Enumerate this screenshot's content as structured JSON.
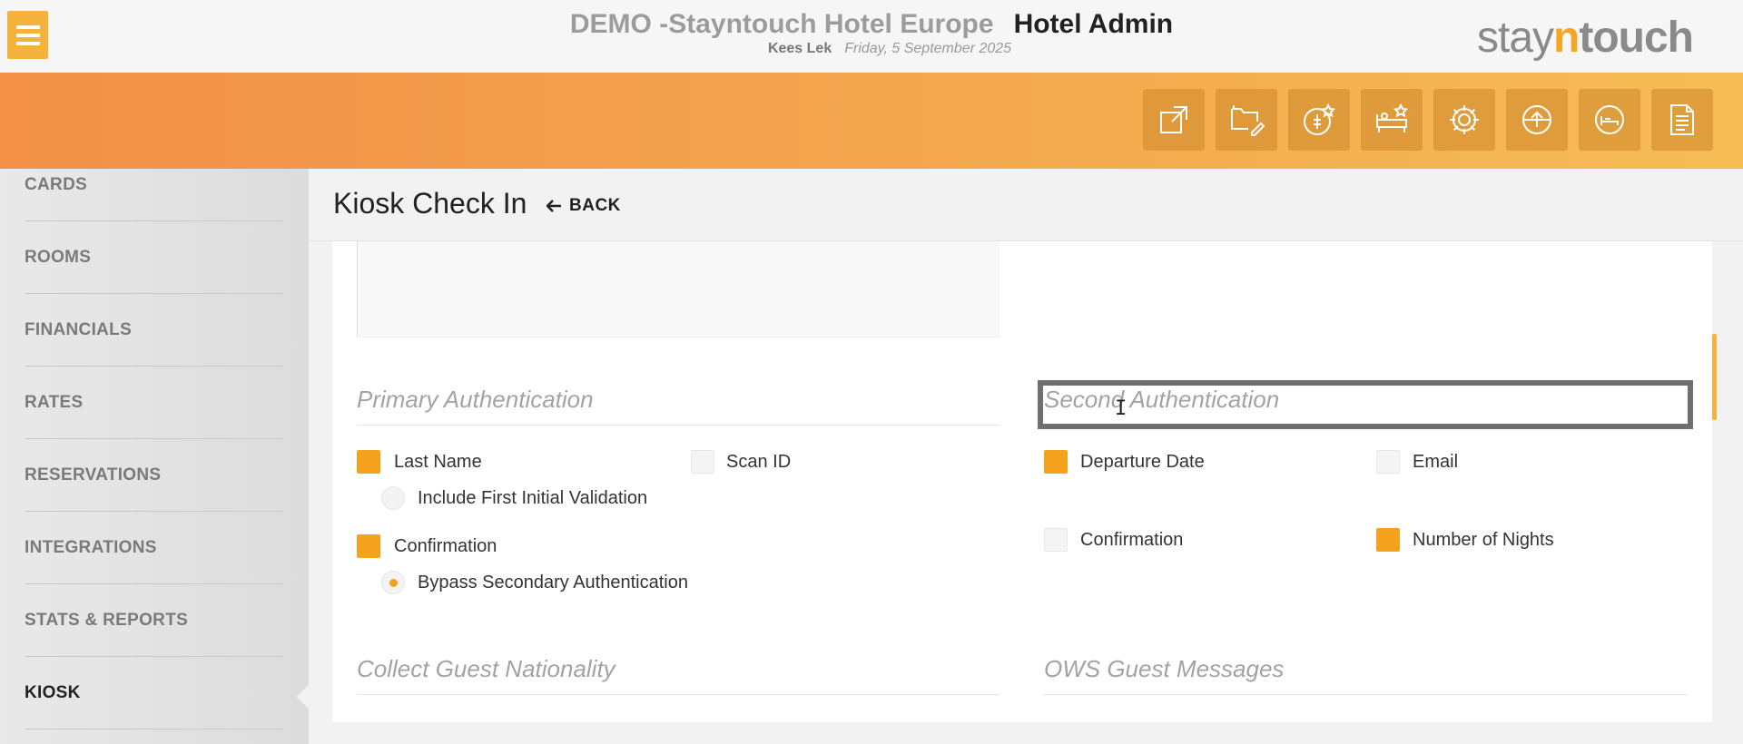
{
  "header": {
    "hotel_name": "DEMO -Stayntouch Hotel Europe",
    "app_name": "Hotel Admin",
    "user": "Kees Lek",
    "date": "Friday, 5 September 2025",
    "logo": {
      "part1": "stay",
      "part2": "n",
      "part3": "touch"
    }
  },
  "toolbar": {
    "icons": [
      "external-link-icon",
      "folder-edit-icon",
      "rate-star-icon",
      "housekeeping-icon",
      "gear-icon",
      "upload-icon",
      "bed-icon",
      "document-icon"
    ]
  },
  "sidebar": {
    "items": [
      {
        "label": "CARDS"
      },
      {
        "label": "ROOMS"
      },
      {
        "label": "FINANCIALS"
      },
      {
        "label": "RATES"
      },
      {
        "label": "RESERVATIONS"
      },
      {
        "label": "INTEGRATIONS"
      },
      {
        "label": "STATS & REPORTS"
      },
      {
        "label": "KIOSK"
      }
    ],
    "active": "KIOSK"
  },
  "page": {
    "title": "Kiosk Check In",
    "back_label": "BACK"
  },
  "primary_auth": {
    "heading": "Primary Authentication",
    "last_name": {
      "label": "Last Name",
      "checked": true
    },
    "include_first_initial": {
      "label": "Include First Initial Validation",
      "selected": false
    },
    "scan_id": {
      "label": "Scan ID",
      "checked": false
    },
    "confirmation": {
      "label": "Confirmation",
      "checked": true
    },
    "bypass_secondary": {
      "label": "Bypass Secondary Authentication",
      "selected": true
    }
  },
  "secondary_auth": {
    "heading": "Second Authentication",
    "departure_date": {
      "label": "Departure Date",
      "checked": true
    },
    "email": {
      "label": "Email",
      "checked": false
    },
    "confirmation": {
      "label": "Confirmation",
      "checked": false
    },
    "number_of_nights": {
      "label": "Number of Nights",
      "checked": true
    }
  },
  "sections": {
    "collect_nationality": "Collect Guest Nationality",
    "ows_messages": "OWS Guest Messages"
  },
  "colors": {
    "accent": "#f5a21f",
    "band_start": "#f29048",
    "band_end": "#f5bc55"
  }
}
